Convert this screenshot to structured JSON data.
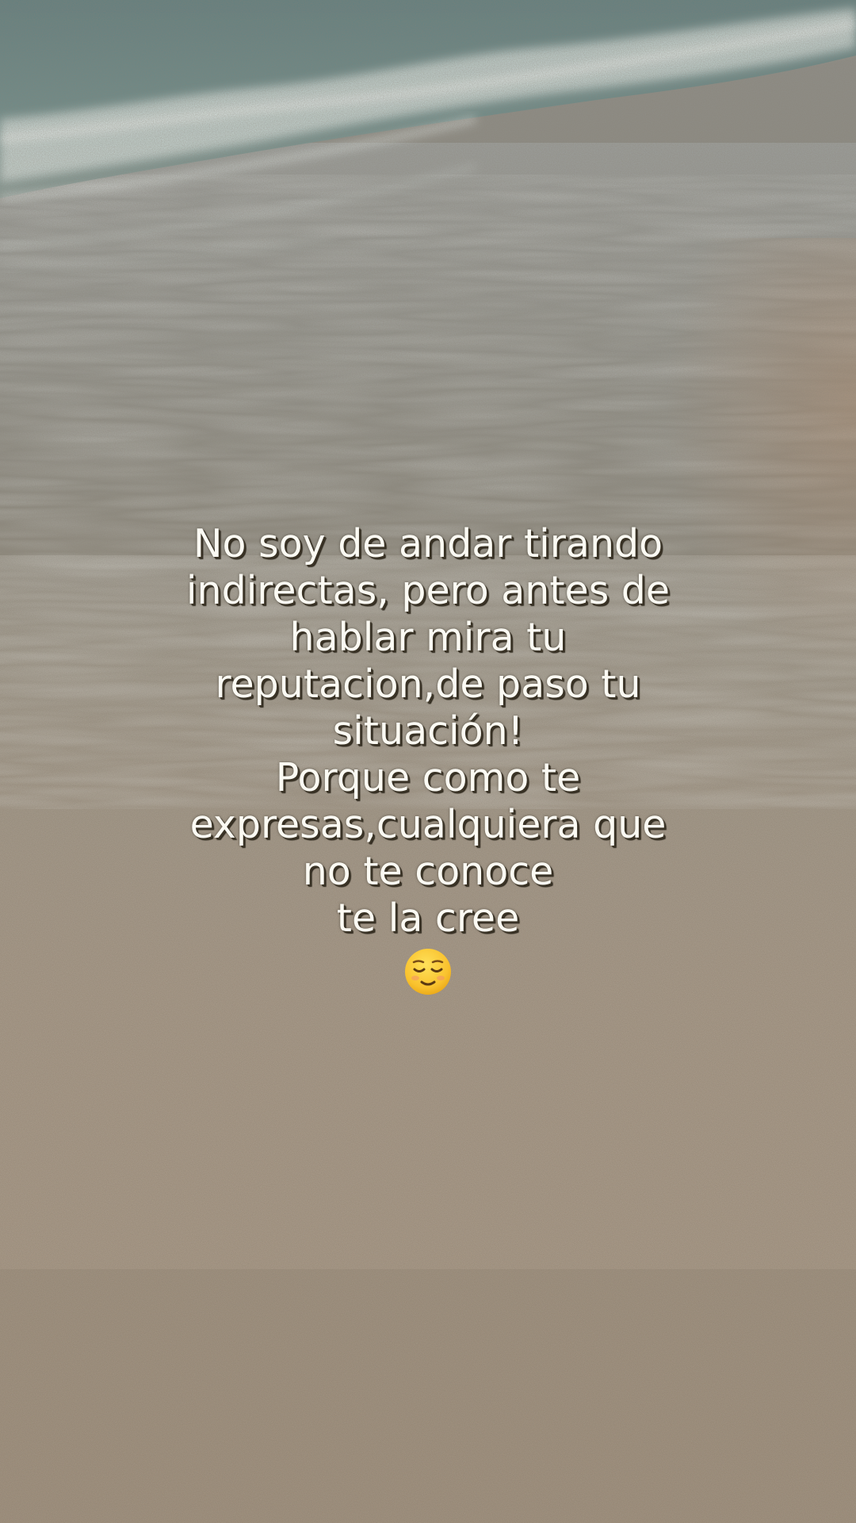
{
  "overlay_text": {
    "lines": [
      "No soy de andar tirando",
      "indirectas, pero antes de",
      "hablar mira tu",
      "reputacion,de paso tu",
      "situación!",
      "Porque como te",
      "expresas,cualquiera que",
      "no te conoce",
      "te la cree"
    ],
    "emoji": "relieved-face-emoji"
  },
  "scene": {
    "subject": "beach-shoreline-wave-over-sand",
    "colors": {
      "sea": "#6f8c8a",
      "foam": "#e6eeec",
      "wet_sand": "#8d8472",
      "dry_sand": "#9a8772",
      "text": "#fbfaf3",
      "text_shadow": "#3a3326"
    }
  }
}
